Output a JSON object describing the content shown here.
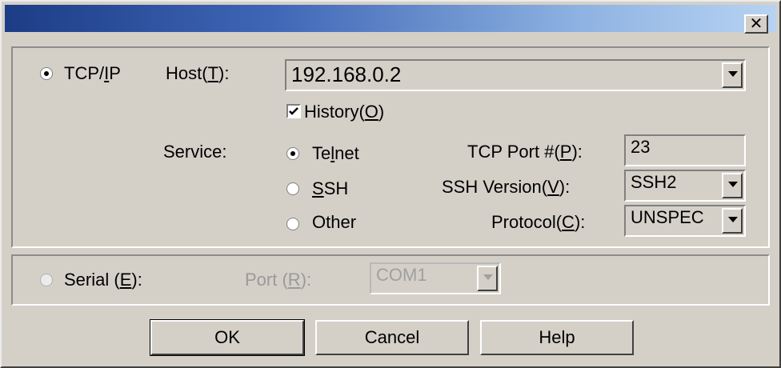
{
  "window": {
    "close_glyph": "✕"
  },
  "tcpip": {
    "radio_label_pre": "TCP/",
    "radio_label_key": "I",
    "radio_label_post": "P",
    "host_label_pre": "Host(",
    "host_label_key": "T",
    "host_label_post": "):",
    "host_value": "192.168.0.2",
    "history_label_pre": "History(",
    "history_label_key": "O",
    "history_label_post": ")",
    "service_label": "Service:",
    "telnet_pre": "Te",
    "telnet_key": "l",
    "telnet_post": "net",
    "ssh_key": "S",
    "ssh_post": "SH",
    "other_label": "Other",
    "tcp_port_pre": "TCP Port #(",
    "tcp_port_key": "P",
    "tcp_port_post": "):",
    "tcp_port_value": "23",
    "ssh_version_pre": "SSH Version(",
    "ssh_version_key": "V",
    "ssh_version_post": "):",
    "ssh_version_value": "SSH2",
    "protocol_pre": "Protocol(",
    "protocol_key": "C",
    "protocol_post": "):",
    "protocol_value": "UNSPEC"
  },
  "serial": {
    "radio_label_pre": "Serial (",
    "radio_label_key": "E",
    "radio_label_post": "):",
    "port_label_pre": "Port (",
    "port_label_key": "R",
    "port_label_post": "):",
    "port_value": "COM1"
  },
  "buttons": {
    "ok": "OK",
    "cancel": "Cancel",
    "help": "Help"
  }
}
